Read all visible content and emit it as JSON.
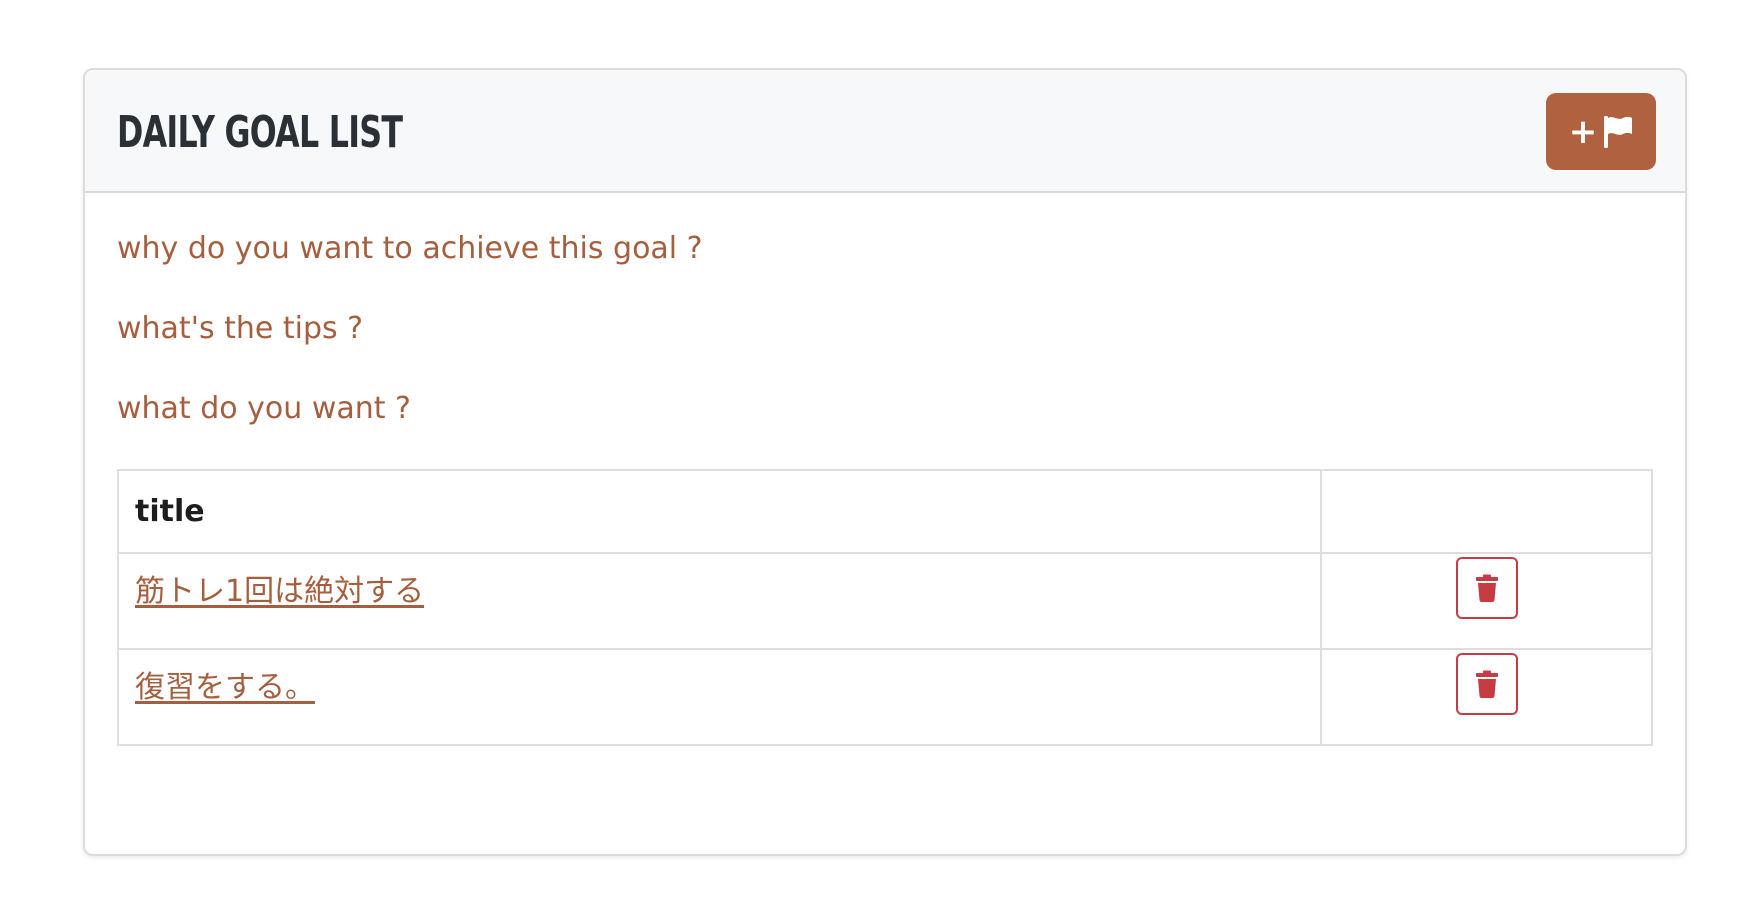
{
  "card": {
    "title": "DAILY GOAL LIST",
    "add_button_icons": [
      "plus-icon",
      "flag-icon"
    ]
  },
  "questions": [
    "why do you want to achieve this goal ?",
    "what's the tips ?",
    "what do you want ?"
  ],
  "table": {
    "headers": [
      "title",
      ""
    ],
    "rows": [
      {
        "title": "筋トレ1回は絶対する",
        "action_icon": "trash-icon"
      },
      {
        "title": "復習をする。",
        "action_icon": "trash-icon"
      }
    ]
  },
  "colors": {
    "accent": "#b06240",
    "link": "#a55f3f",
    "danger": "#c63c44",
    "header_bg": "#f7f8f9",
    "title_text": "#2b3036"
  }
}
